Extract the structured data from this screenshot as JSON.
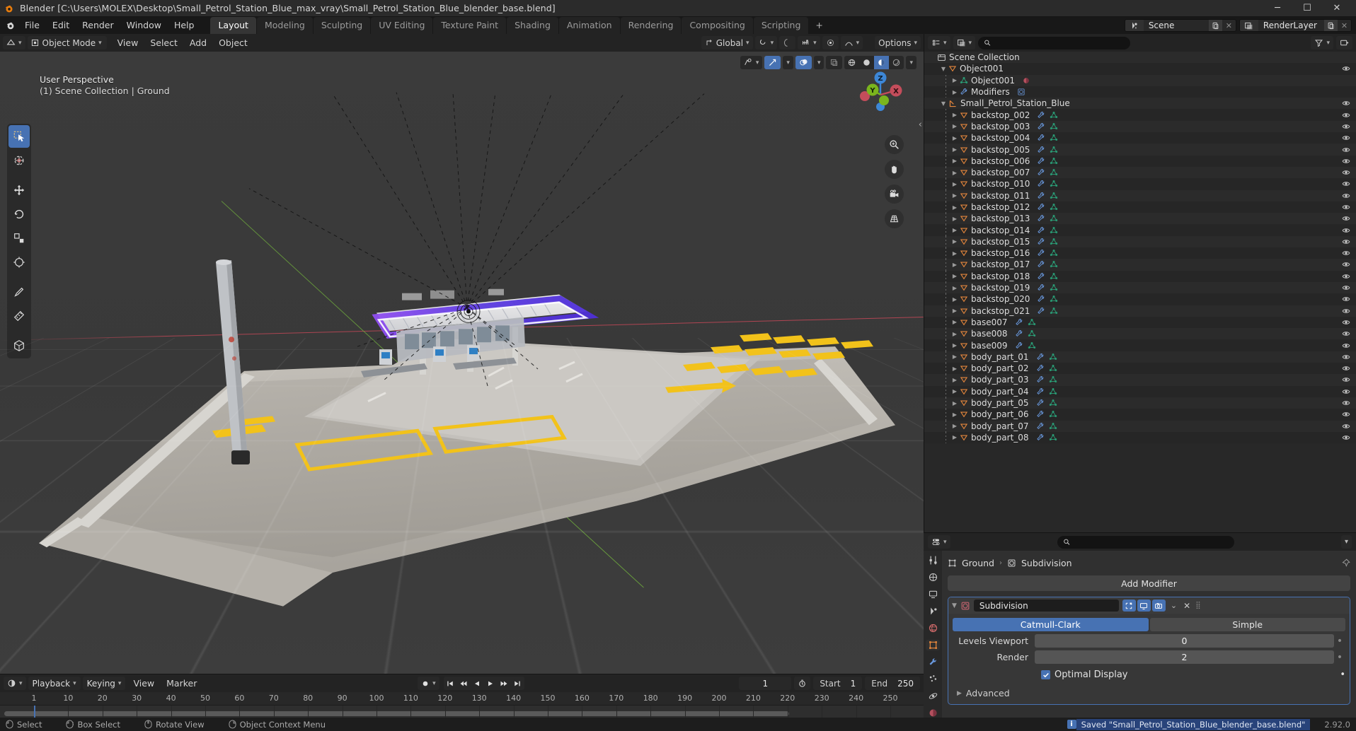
{
  "window": {
    "title": "Blender [C:\\Users\\MOLEX\\Desktop\\Small_Petrol_Station_Blue_max_vray\\Small_Petrol_Station_Blue_blender_base.blend]",
    "minimize": "─",
    "maximize": "☐",
    "close": "✕"
  },
  "topbar": {
    "menus": [
      "File",
      "Edit",
      "Render",
      "Window",
      "Help"
    ],
    "workspaces": [
      "Layout",
      "Modeling",
      "Sculpting",
      "UV Editing",
      "Texture Paint",
      "Shading",
      "Animation",
      "Rendering",
      "Compositing",
      "Scripting"
    ],
    "active_workspace": "Layout",
    "add_workspace": "+",
    "scene_name": "Scene",
    "viewlayer_name": "RenderLayer"
  },
  "viewport": {
    "mode": "Object Mode",
    "menus": [
      "View",
      "Select",
      "Add",
      "Object"
    ],
    "transform_orientation": "Global",
    "options_label": "Options",
    "overlay_line1": "User Perspective",
    "overlay_line2": "(1) Scene Collection | Ground",
    "gizmo_axes": [
      "X",
      "Y",
      "Z"
    ],
    "colors": {
      "axis_x": "#c44d5b",
      "axis_y": "#7ab51d",
      "axis_z": "#3d87d6",
      "accent_blue": "#4772b3",
      "canopy_glow": "#5b3ce0",
      "road_marking": "#f2c21a"
    }
  },
  "timeline": {
    "menus": [
      "View",
      "Marker"
    ],
    "playback_label": "Playback",
    "keying_label": "Keying",
    "current_frame": "1",
    "start_label": "Start",
    "start_value": "1",
    "end_label": "End",
    "end_value": "250",
    "ticks": [
      "1",
      "10",
      "20",
      "30",
      "40",
      "50",
      "60",
      "70",
      "80",
      "90",
      "100",
      "110",
      "120",
      "130",
      "140",
      "150",
      "160",
      "170",
      "180",
      "190",
      "200",
      "210",
      "220",
      "230",
      "240",
      "250"
    ],
    "playhead_frame": "1"
  },
  "outliner": {
    "search_placeholder": "",
    "items": [
      {
        "label": "Scene Collection",
        "depth": 0,
        "icon": "collection-icon",
        "expand": "",
        "eye": false,
        "modifier": false,
        "mesh": false
      },
      {
        "label": "Object001",
        "depth": 1,
        "icon": "object-icon",
        "expand": "▼",
        "eye": true,
        "modifier": false,
        "mesh": false
      },
      {
        "label": "Object001",
        "depth": 2,
        "icon": "mesh-data-icon",
        "expand": "▶",
        "eye": false,
        "modifier": false,
        "mesh": false,
        "material": true
      },
      {
        "label": "Modifiers",
        "depth": 2,
        "icon": "wrench-icon",
        "expand": "▶",
        "eye": false,
        "modifier": false,
        "mesh": false,
        "subsurf": true
      },
      {
        "label": "Small_Petrol_Station_Blue",
        "depth": 1,
        "icon": "empty-icon",
        "expand": "▼",
        "eye": true,
        "modifier": false,
        "mesh": false
      },
      {
        "label": "backstop_002",
        "depth": 2,
        "icon": "object-icon",
        "expand": "▶",
        "eye": true,
        "modifier": true,
        "mesh": true
      },
      {
        "label": "backstop_003",
        "depth": 2,
        "icon": "object-icon",
        "expand": "▶",
        "eye": true,
        "modifier": true,
        "mesh": true
      },
      {
        "label": "backstop_004",
        "depth": 2,
        "icon": "object-icon",
        "expand": "▶",
        "eye": true,
        "modifier": true,
        "mesh": true
      },
      {
        "label": "backstop_005",
        "depth": 2,
        "icon": "object-icon",
        "expand": "▶",
        "eye": true,
        "modifier": true,
        "mesh": true
      },
      {
        "label": "backstop_006",
        "depth": 2,
        "icon": "object-icon",
        "expand": "▶",
        "eye": true,
        "modifier": true,
        "mesh": true
      },
      {
        "label": "backstop_007",
        "depth": 2,
        "icon": "object-icon",
        "expand": "▶",
        "eye": true,
        "modifier": true,
        "mesh": true
      },
      {
        "label": "backstop_010",
        "depth": 2,
        "icon": "object-icon",
        "expand": "▶",
        "eye": true,
        "modifier": true,
        "mesh": true
      },
      {
        "label": "backstop_011",
        "depth": 2,
        "icon": "object-icon",
        "expand": "▶",
        "eye": true,
        "modifier": true,
        "mesh": true
      },
      {
        "label": "backstop_012",
        "depth": 2,
        "icon": "object-icon",
        "expand": "▶",
        "eye": true,
        "modifier": true,
        "mesh": true
      },
      {
        "label": "backstop_013",
        "depth": 2,
        "icon": "object-icon",
        "expand": "▶",
        "eye": true,
        "modifier": true,
        "mesh": true
      },
      {
        "label": "backstop_014",
        "depth": 2,
        "icon": "object-icon",
        "expand": "▶",
        "eye": true,
        "modifier": true,
        "mesh": true
      },
      {
        "label": "backstop_015",
        "depth": 2,
        "icon": "object-icon",
        "expand": "▶",
        "eye": true,
        "modifier": true,
        "mesh": true
      },
      {
        "label": "backstop_016",
        "depth": 2,
        "icon": "object-icon",
        "expand": "▶",
        "eye": true,
        "modifier": true,
        "mesh": true
      },
      {
        "label": "backstop_017",
        "depth": 2,
        "icon": "object-icon",
        "expand": "▶",
        "eye": true,
        "modifier": true,
        "mesh": true
      },
      {
        "label": "backstop_018",
        "depth": 2,
        "icon": "object-icon",
        "expand": "▶",
        "eye": true,
        "modifier": true,
        "mesh": true
      },
      {
        "label": "backstop_019",
        "depth": 2,
        "icon": "object-icon",
        "expand": "▶",
        "eye": true,
        "modifier": true,
        "mesh": true
      },
      {
        "label": "backstop_020",
        "depth": 2,
        "icon": "object-icon",
        "expand": "▶",
        "eye": true,
        "modifier": true,
        "mesh": true
      },
      {
        "label": "backstop_021",
        "depth": 2,
        "icon": "object-icon",
        "expand": "▶",
        "eye": true,
        "modifier": true,
        "mesh": true
      },
      {
        "label": "base007",
        "depth": 2,
        "icon": "object-icon",
        "expand": "▶",
        "eye": true,
        "modifier": true,
        "mesh": true
      },
      {
        "label": "base008",
        "depth": 2,
        "icon": "object-icon",
        "expand": "▶",
        "eye": true,
        "modifier": true,
        "mesh": true
      },
      {
        "label": "base009",
        "depth": 2,
        "icon": "object-icon",
        "expand": "▶",
        "eye": true,
        "modifier": true,
        "mesh": true
      },
      {
        "label": "body_part_01",
        "depth": 2,
        "icon": "object-icon",
        "expand": "▶",
        "eye": true,
        "modifier": true,
        "mesh": true
      },
      {
        "label": "body_part_02",
        "depth": 2,
        "icon": "object-icon",
        "expand": "▶",
        "eye": true,
        "modifier": true,
        "mesh": true
      },
      {
        "label": "body_part_03",
        "depth": 2,
        "icon": "object-icon",
        "expand": "▶",
        "eye": true,
        "modifier": true,
        "mesh": true
      },
      {
        "label": "body_part_04",
        "depth": 2,
        "icon": "object-icon",
        "expand": "▶",
        "eye": true,
        "modifier": true,
        "mesh": true
      },
      {
        "label": "body_part_05",
        "depth": 2,
        "icon": "object-icon",
        "expand": "▶",
        "eye": true,
        "modifier": true,
        "mesh": true
      },
      {
        "label": "body_part_06",
        "depth": 2,
        "icon": "object-icon",
        "expand": "▶",
        "eye": true,
        "modifier": true,
        "mesh": true
      },
      {
        "label": "body_part_07",
        "depth": 2,
        "icon": "object-icon",
        "expand": "▶",
        "eye": true,
        "modifier": true,
        "mesh": true
      },
      {
        "label": "body_part_08",
        "depth": 2,
        "icon": "object-icon",
        "expand": "▶",
        "eye": true,
        "modifier": true,
        "mesh": true
      }
    ]
  },
  "properties": {
    "search_placeholder": "",
    "breadcrumb_object": "Ground",
    "breadcrumb_modifier": "Subdivision",
    "add_modifier_label": "Add Modifier",
    "modifier": {
      "name": "Subdivision",
      "type_catmull": "Catmull-Clark",
      "type_simple": "Simple",
      "active_type": "Catmull-Clark",
      "levels_viewport_label": "Levels Viewport",
      "levels_viewport_value": "0",
      "render_label": "Render",
      "render_value": "2",
      "optimal_display_label": "Optimal Display",
      "optimal_display_checked": true,
      "advanced_label": "Advanced",
      "close_glyph": "✕",
      "chevron_glyph": "⌄"
    }
  },
  "statusbar": {
    "hints": [
      {
        "label": "Select"
      },
      {
        "label": "Box Select"
      },
      {
        "label": "Rotate View"
      },
      {
        "label": "Object Context Menu"
      }
    ],
    "info_badge": "i",
    "message": "Saved \"Small_Petrol_Station_Blue_blender_base.blend\"",
    "version": "2.92.0"
  }
}
